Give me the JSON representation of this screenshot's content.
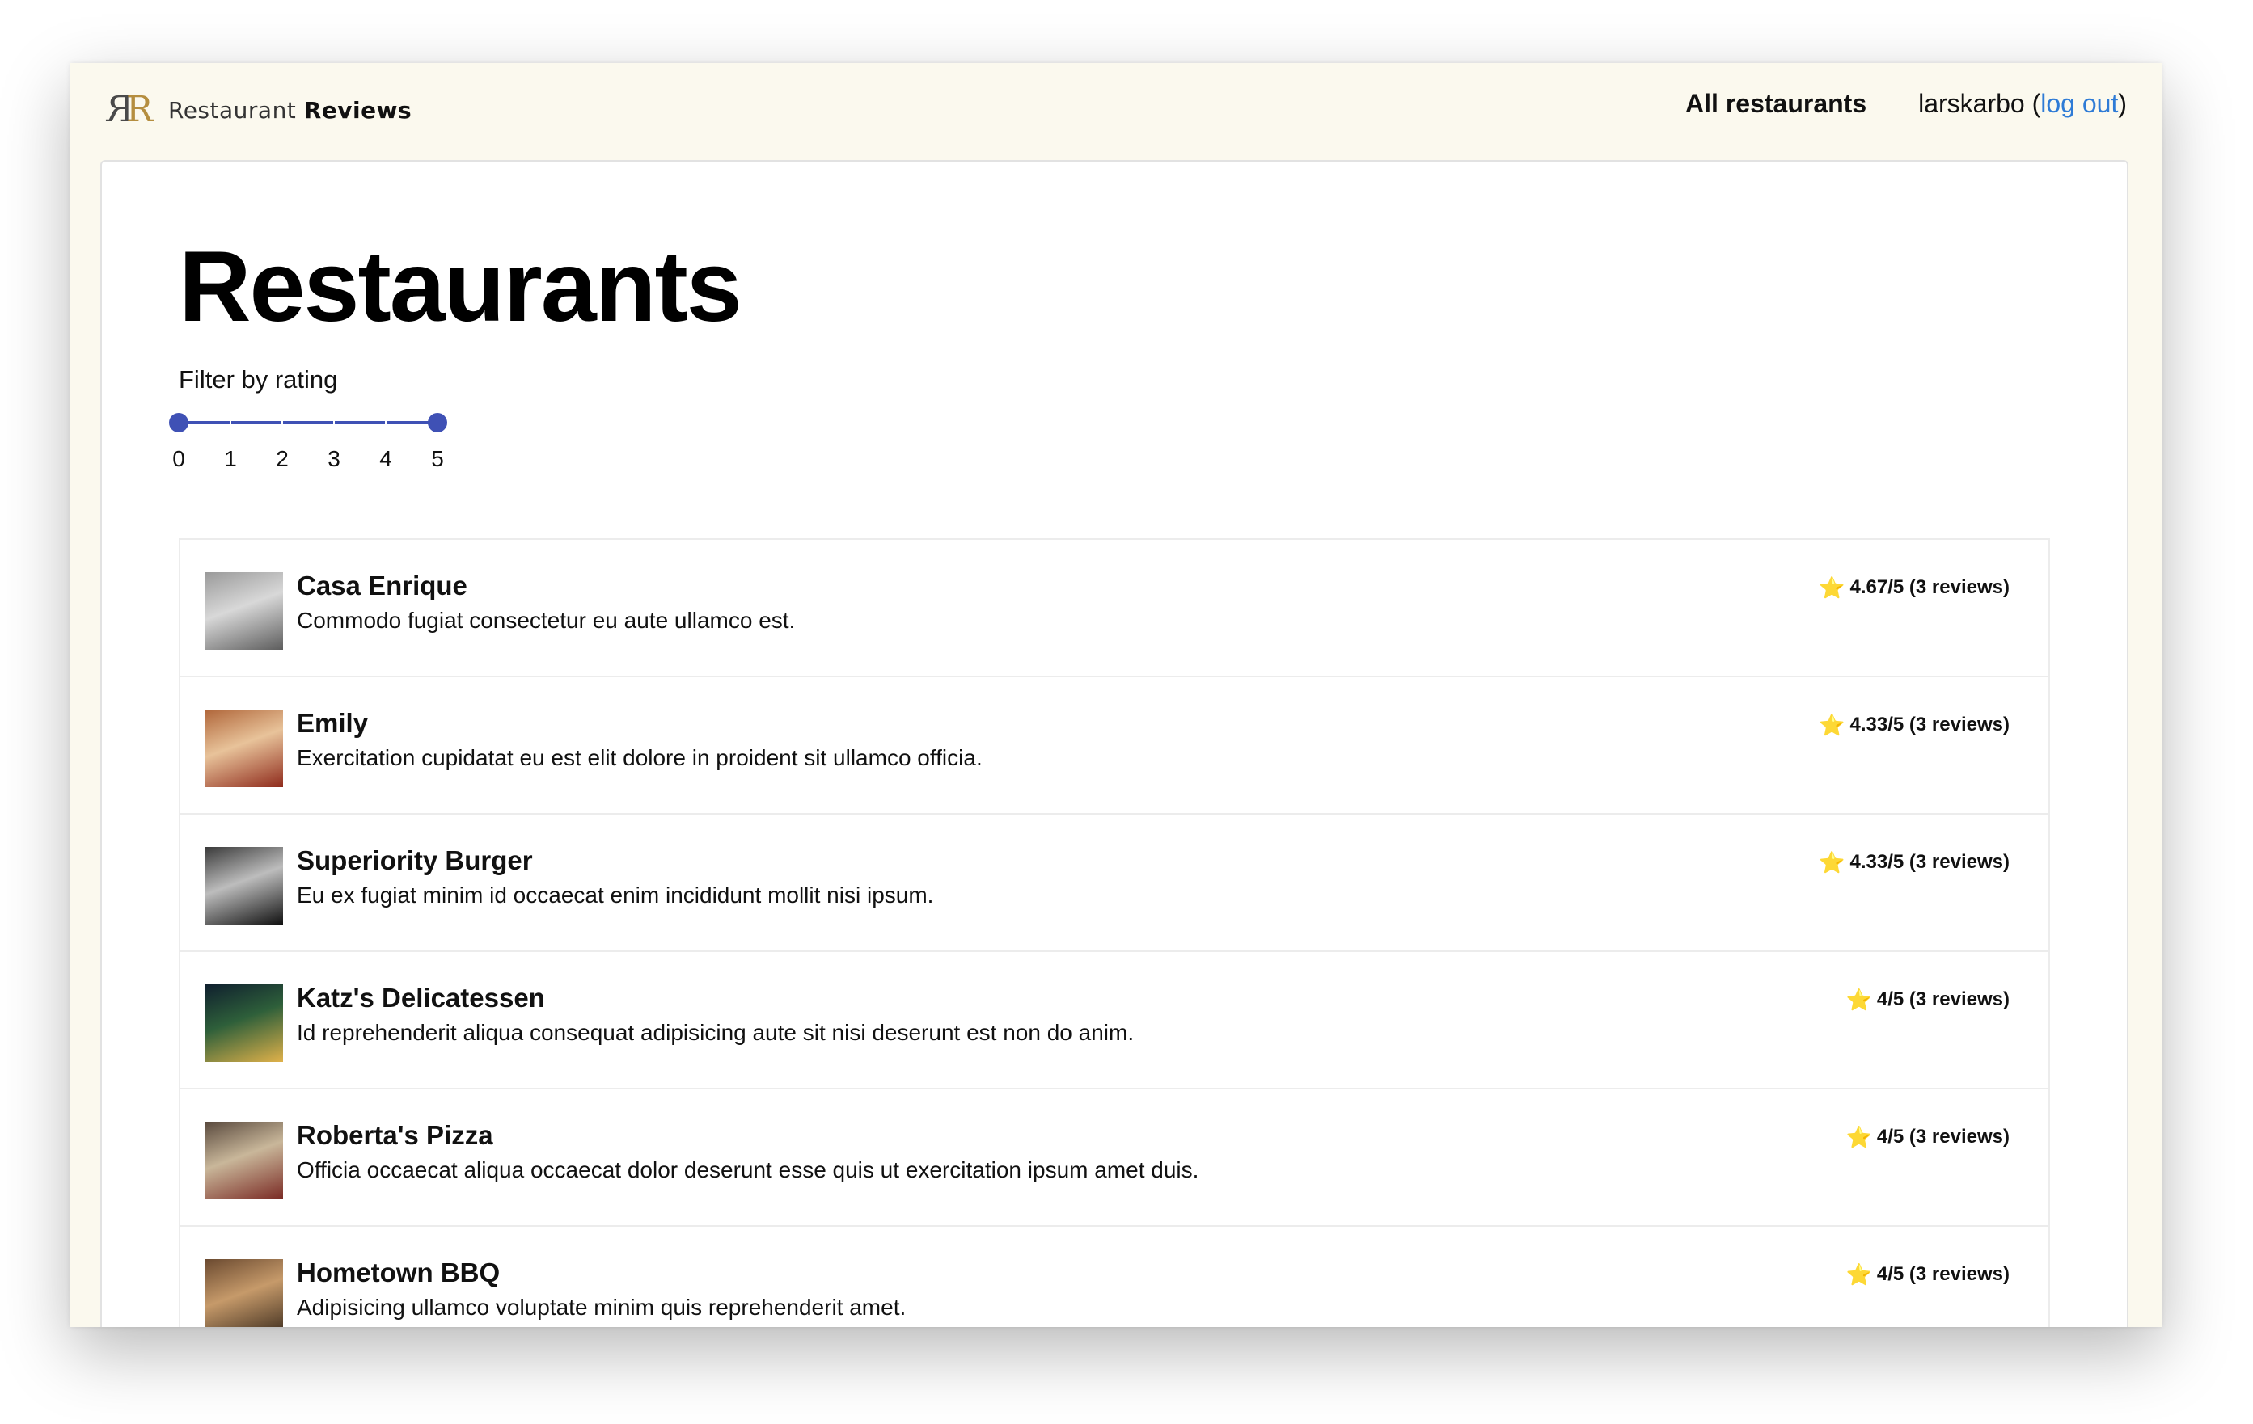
{
  "header": {
    "logo_light": "Restaurant",
    "logo_bold": "Reviews",
    "nav_all": "All restaurants",
    "username": "larskarbo",
    "paren_open": " (",
    "logout": "log out",
    "paren_close": ")"
  },
  "page": {
    "title": "Restaurants",
    "filter_label": "Filter by rating"
  },
  "filter": {
    "marks": [
      "0",
      "1",
      "2",
      "3",
      "4",
      "5"
    ],
    "range_min": 0,
    "range_max": 5
  },
  "colors": {
    "slider": "#3f51b5",
    "star": "#f3c20f",
    "link": "#2e7bd6",
    "header_bg": "#fbf9ee"
  },
  "restaurants": [
    {
      "name": "Casa Enrique",
      "description": "Commodo fugiat consectetur eu aute ullamco est.",
      "rating_text": "4.67/5 (3 reviews)",
      "thumb_colors": [
        "#9a9a9a",
        "#d8d8d8",
        "#5d5d5d"
      ]
    },
    {
      "name": "Emily",
      "description": "Exercitation cupidatat eu est elit dolore in proident sit ullamco officia.",
      "rating_text": "4.33/5 (3 reviews)",
      "thumb_colors": [
        "#b0663a",
        "#e8c39a",
        "#8f2b1c"
      ]
    },
    {
      "name": "Superiority Burger",
      "description": "Eu ex fugiat minim id occaecat enim incididunt mollit nisi ipsum.",
      "rating_text": "4.33/5 (3 reviews)",
      "thumb_colors": [
        "#3a3a3a",
        "#bdbdbd",
        "#111111"
      ]
    },
    {
      "name": "Katz's Delicatessen",
      "description": "Id reprehenderit aliqua consequat adipisicing aute sit nisi deserunt est non do anim.",
      "rating_text": "4/5 (3 reviews)",
      "thumb_colors": [
        "#0f1f2e",
        "#2e5f3a",
        "#e0b14a"
      ]
    },
    {
      "name": "Roberta's Pizza",
      "description": "Officia occaecat aliqua occaecat dolor deserunt esse quis ut exercitation ipsum amet duis.",
      "rating_text": "4/5 (3 reviews)",
      "thumb_colors": [
        "#5a4a3e",
        "#c9b79a",
        "#7a2a24"
      ]
    },
    {
      "name": "Hometown BBQ",
      "description": "Adipisicing ullamco voluptate minim quis reprehenderit amet.",
      "rating_text": "4/5 (3 reviews)",
      "thumb_colors": [
        "#6b4a30",
        "#c69a6a",
        "#3a2a1c"
      ]
    }
  ]
}
